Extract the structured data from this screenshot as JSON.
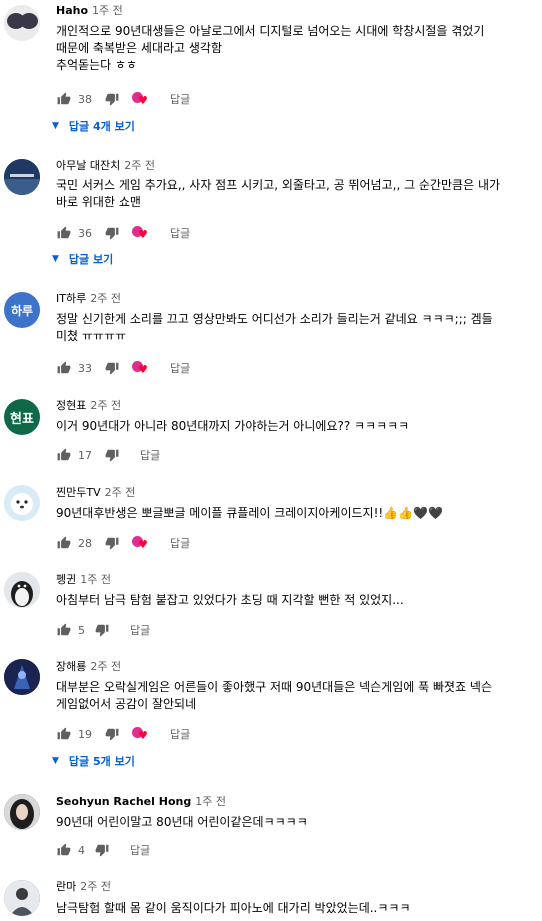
{
  "comments": [
    {
      "author": "Haho",
      "time": "1주 전",
      "text": "개인적으로 90년대생들은 아날로그에서 디지털로 넘어오는 시대에 학창시절을 겪었기\n때문에 축복받은 세대라고 생각함\n추억돋는다 ㅎㅎ",
      "likes": "38",
      "reply_label": "답글",
      "replies_label": "답글 4개 보기",
      "avatar_color": "#3a3846"
    },
    {
      "author": "아무날 대잔치",
      "time": "2주 전",
      "text": "국민 서커스 게임 추가요,, 사자 점프 시키고, 외줄타고, 공 뛰어넘고,, 그 순간만큼은 내가\n바로 위대한 쇼맨",
      "likes": "36",
      "reply_label": "답글",
      "replies_label": "답글 보기",
      "avatar_color": "#1e3a63"
    },
    {
      "author": "IT하루",
      "time": "2주 전",
      "text": "정말 신기한게 소리를 끄고 영상만봐도 어디선가 소리가 들리는거 같네요 ㅋㅋㅋ;;; 겜들\n미쳤 ㅠㅠㅠㅠ",
      "likes": "33",
      "reply_label": "답글",
      "avatar_text": "하루",
      "avatar_color": "#3d73c9"
    },
    {
      "author": "정현표",
      "time": "2주 전",
      "text": "이거 90년대가 아니라 80년대까지 가야하는거 아니에요?? ㅋㅋㅋㅋㅋ",
      "likes": "17",
      "reply_label": "답글",
      "avatar_text": "현표",
      "avatar_color": "#0f6848"
    },
    {
      "author": "찐만두TV",
      "time": "2주 전",
      "text": "90년대후반생은 뽀글뽀글 메이플 큐플레이 크레이지아케이드지!!👍👍🖤🖤",
      "likes": "28",
      "reply_label": "답글",
      "avatar_color": "#d9ebf7"
    },
    {
      "author": "펭귄",
      "time": "1주 전",
      "text": "아침부터 남극 탐험 붙잡고 있었다가 초딩 때 지각할 뻔한 적 있었지...",
      "likes": "5",
      "reply_label": "답글",
      "avatar_color": "#cfd3d8"
    },
    {
      "author": "장해룡",
      "time": "2주 전",
      "text": "대부분은 오락실게임은 어른들이 좋아했구 저때 90년대들은 넥슨게임에 푹 빠졋죠 넥슨\n게임없어서 공감이 잘안되네",
      "likes": "19",
      "reply_label": "답글",
      "replies_label": "답글 5개 보기",
      "avatar_color": "#1b2450"
    },
    {
      "author": "Seohyun Rachel Hong",
      "time": "1주 전",
      "text": "90년대 어린이말고 80년대 어린이같은데ㅋㅋㅋㅋ",
      "likes": "4",
      "reply_label": "답글",
      "avatar_color": "#2a2a2a"
    },
    {
      "author": "란마",
      "time": "2주 전",
      "text": "남극탐험 할때 몸 같이 움직이다가 피아노에 대가리 박았었는데..ㅋㅋㅋ",
      "avatar_color": "#5b5f66"
    }
  ],
  "icons": {
    "like": "thumbs-up-icon",
    "dislike": "thumbs-down-icon",
    "creator_heart": "creator-heart-icon",
    "expand": "caret-down-icon"
  }
}
